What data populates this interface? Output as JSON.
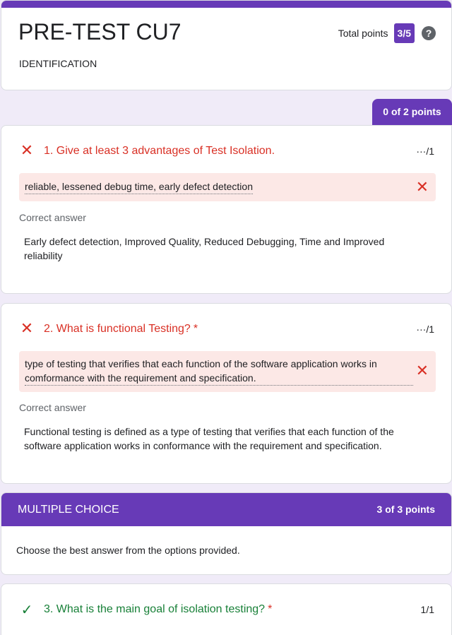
{
  "form": {
    "title": "PRE-TEST CU7",
    "description": "IDENTIFICATION",
    "total_label": "Total points",
    "total_value": "3/5",
    "help_icon": "?"
  },
  "section1": {
    "points": "0 of 2 points"
  },
  "q1": {
    "title": "1. Give at least 3 advantages of Test Isolation.",
    "score": "···/1",
    "answer": "reliable, lessened debug time, early defect detection",
    "correct_label": "Correct answer",
    "correct": "Early defect detection, Improved Quality, Reduced Debugging, Time and Improved reliability"
  },
  "q2": {
    "title": "2. What is functional Testing?",
    "required": "*",
    "score": "···/1",
    "answer": "type of testing that verifies that each function of the software application works in comformance with the requirement and specification.",
    "correct_label": "Correct answer",
    "correct": "Functional testing is defined as a type of testing that verifies that each function of the software application works in conformance with the requirement and specification."
  },
  "section2": {
    "title": "MULTIPLE CHOICE",
    "points": "3 of 3 points",
    "description": "Choose the best answer from the options provided."
  },
  "q3": {
    "title": "3. What is the main goal of isolation testing?",
    "required": "*",
    "score": "1/1"
  },
  "icons": {
    "wrong": "✕",
    "right": "✓"
  },
  "colors": {
    "accent": "#673ab7",
    "error": "#d93025",
    "success": "#188038",
    "answer_bg": "#fce8e6"
  }
}
